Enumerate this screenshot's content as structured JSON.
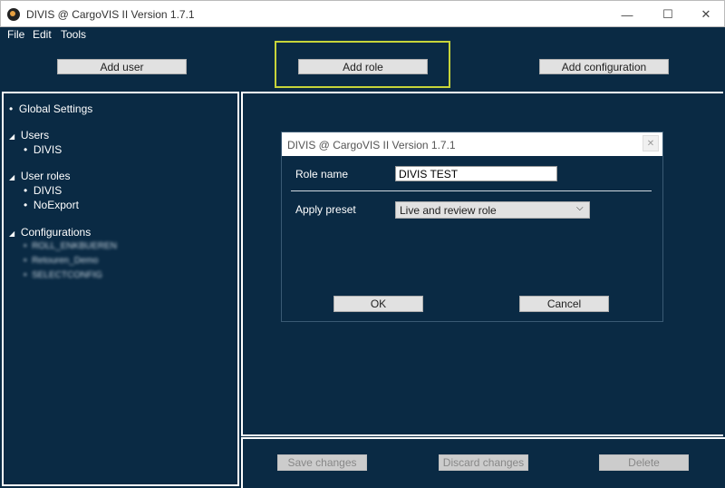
{
  "window": {
    "title": "DIVIS @ CargoVIS II Version 1.7.1",
    "controls": {
      "minimize": "—",
      "maximize": "☐",
      "close": "✕"
    }
  },
  "menu": {
    "file": "File",
    "edit": "Edit",
    "tools": "Tools"
  },
  "toolbar": {
    "add_user": "Add user",
    "add_role": "Add role",
    "add_configuration": "Add configuration"
  },
  "tree": {
    "global_settings": "Global Settings",
    "users": {
      "label": "Users",
      "items": [
        "DIVIS"
      ]
    },
    "user_roles": {
      "label": "User roles",
      "items": [
        "DIVIS",
        "NoExport"
      ]
    },
    "configurations": {
      "label": "Configurations",
      "items": [
        "ROLL_ENKBUEREN",
        "Retouren_Demo",
        "SELECTCONFIG"
      ]
    }
  },
  "dialog": {
    "title": "DIVIS @ CargoVIS II Version 1.7.1",
    "close": "✕",
    "role_name_label": "Role name",
    "role_name_value": "DIVIS TEST",
    "apply_preset_label": "Apply preset",
    "preset_value": "Live and review role",
    "ok": "OK",
    "cancel": "Cancel"
  },
  "footer": {
    "save_changes": "Save changes",
    "discard_changes": "Discard changes",
    "delete": "Delete"
  },
  "colors": {
    "background": "#0a2a44",
    "highlight": "#c7d43a",
    "button": "#e1e1e1"
  }
}
